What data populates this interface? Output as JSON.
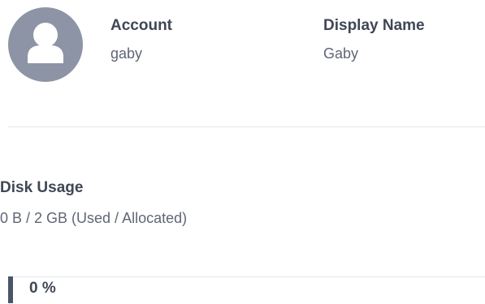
{
  "profile": {
    "avatar_icon": "user-avatar-icon",
    "account_label": "Account",
    "account_value": "gaby",
    "display_name_label": "Display Name",
    "display_name_value": "Gaby"
  },
  "disk": {
    "label": "Disk Usage",
    "value": "0 B / 2 GB (Used / Allocated)",
    "progress_percent": 0,
    "progress_text": "0 %"
  },
  "colors": {
    "avatar_bg": "#8d94a5",
    "text_primary": "#3f4756",
    "text_secondary": "#5f6676",
    "divider": "#e3e6eb",
    "progress_marker": "#4b5569"
  }
}
